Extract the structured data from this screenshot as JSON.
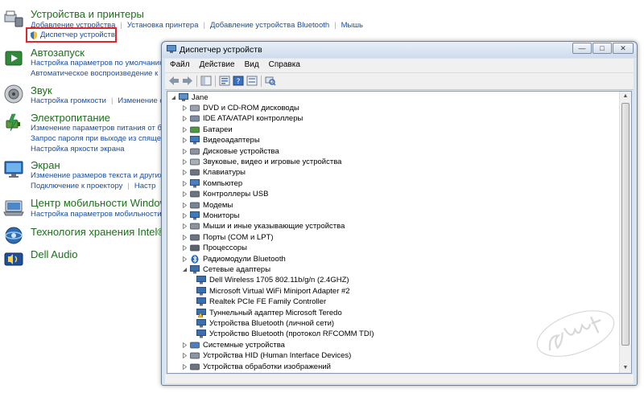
{
  "control_panel": {
    "devices": {
      "title": "Устройства и принтеры",
      "links": [
        "Добавление устройства",
        "Установка принтера",
        "Добавление устройства Bluetooth",
        "Мышь"
      ],
      "device_manager": "Диспетчер устройств"
    },
    "autoplay": {
      "title": "Автозапуск",
      "line1": "Настройка параметров по умолчанию",
      "line2": "Автоматическое воспроизведение к"
    },
    "sound": {
      "title": "Звук",
      "links": [
        "Настройка громкости",
        "Изменение с"
      ]
    },
    "power": {
      "title": "Электропитание",
      "line1": "Изменение параметров питания от бат",
      "line2": "Запрос пароля при выходе из спящего",
      "line3": "Настройка яркости экрана"
    },
    "display": {
      "title": "Экран",
      "line1": "Изменение размеров текста и других э",
      "links": [
        "Подключение к проектору",
        "Настр"
      ]
    },
    "mobility": {
      "title": "Центр мобильности Windows",
      "line1": "Настройка параметров мобильности"
    },
    "intel": {
      "title": "Технология хранения Intel® Ra"
    },
    "dell_audio": {
      "title": "Dell Audio"
    }
  },
  "window": {
    "title": "Диспетчер устройств",
    "controls": {
      "minimize": "—",
      "maximize": "□",
      "close": "✕"
    },
    "menu": [
      "Файл",
      "Действие",
      "Вид",
      "Справка"
    ],
    "tree": {
      "root": "Jane",
      "items": [
        {
          "label": "DVD и CD-ROM дисководы",
          "icon": "dvd-icon",
          "level": 1,
          "expander": "collapsed"
        },
        {
          "label": "IDE ATA/ATAPI контроллеры",
          "icon": "ide-controller-icon",
          "level": 1,
          "expander": "collapsed"
        },
        {
          "label": "Батареи",
          "icon": "battery-icon",
          "level": 1,
          "expander": "collapsed"
        },
        {
          "label": "Видеоадаптеры",
          "icon": "video-adapter-icon",
          "level": 1,
          "expander": "collapsed"
        },
        {
          "label": "Дисковые устройства",
          "icon": "disk-drive-icon",
          "level": 1,
          "expander": "collapsed"
        },
        {
          "label": "Звуковые, видео и игровые устройства",
          "icon": "sound-device-icon",
          "level": 1,
          "expander": "collapsed"
        },
        {
          "label": "Клавиатуры",
          "icon": "keyboard-icon",
          "level": 1,
          "expander": "collapsed"
        },
        {
          "label": "Компьютер",
          "icon": "computer-icon",
          "level": 1,
          "expander": "collapsed"
        },
        {
          "label": "Контроллеры USB",
          "icon": "usb-controller-icon",
          "level": 1,
          "expander": "collapsed"
        },
        {
          "label": "Модемы",
          "icon": "modem-icon",
          "level": 1,
          "expander": "collapsed"
        },
        {
          "label": "Мониторы",
          "icon": "monitor-icon",
          "level": 1,
          "expander": "collapsed"
        },
        {
          "label": "Мыши и иные указывающие устройства",
          "icon": "mouse-icon",
          "level": 1,
          "expander": "collapsed"
        },
        {
          "label": "Порты (COM и LPT)",
          "icon": "port-icon",
          "level": 1,
          "expander": "collapsed"
        },
        {
          "label": "Процессоры",
          "icon": "processor-icon",
          "level": 1,
          "expander": "collapsed"
        },
        {
          "label": "Радиомодули Bluetooth",
          "icon": "bluetooth-icon",
          "level": 1,
          "expander": "collapsed"
        },
        {
          "label": "Сетевые адаптеры",
          "icon": "network-adapter-icon",
          "level": 1,
          "expander": "expanded"
        },
        {
          "label": "Dell Wireless 1705 802.11b/g/n (2.4GHZ)",
          "icon": "network-adapter-icon",
          "level": 2,
          "expander": "none"
        },
        {
          "label": "Microsoft Virtual WiFi Miniport Adapter #2",
          "icon": "network-adapter-icon",
          "level": 2,
          "expander": "none"
        },
        {
          "label": "Realtek PCIe FE Family Controller",
          "icon": "network-adapter-icon",
          "level": 2,
          "expander": "none"
        },
        {
          "label": "Туннельный адаптер Microsoft Teredo",
          "icon": "warning-network-adapter-icon",
          "level": 2,
          "expander": "none"
        },
        {
          "label": "Устройства Bluetooth (личной сети)",
          "icon": "network-adapter-icon",
          "level": 2,
          "expander": "none"
        },
        {
          "label": "Устройство Bluetooth (протокол RFCOMM TDI)",
          "icon": "network-adapter-icon",
          "level": 2,
          "expander": "none"
        },
        {
          "label": "Системные устройства",
          "icon": "system-device-icon",
          "level": 1,
          "expander": "collapsed"
        },
        {
          "label": "Устройства HID (Human Interface Devices)",
          "icon": "hid-icon",
          "level": 1,
          "expander": "collapsed"
        },
        {
          "label": "Устройства обработки изображений",
          "icon": "camera-icon",
          "level": 1,
          "expander": "collapsed"
        }
      ]
    }
  },
  "colors": {
    "section_title": "#1e6e1e",
    "link": "#1a4fa0",
    "highlight": "#e0262e",
    "window_frame": "#d9e4f1"
  }
}
